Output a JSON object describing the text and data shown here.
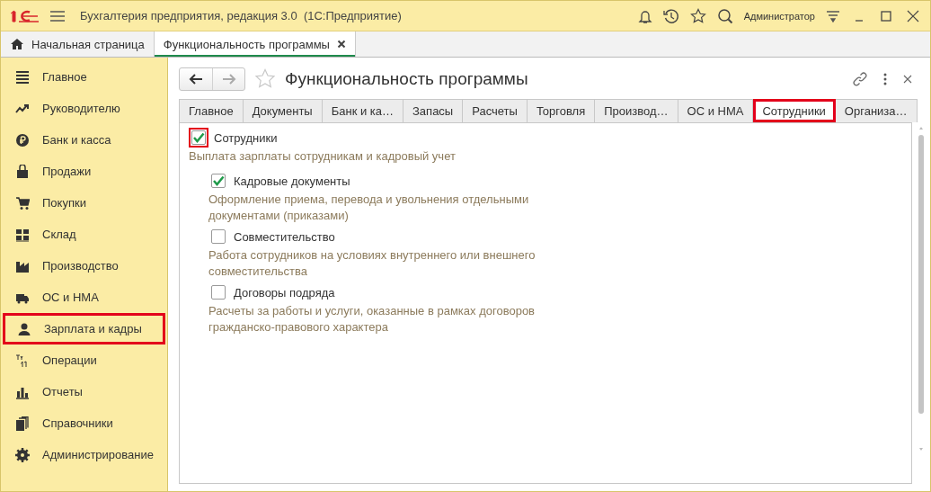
{
  "window": {
    "title": "Бухгалтерия предприятия, редакция 3.0  (1С:Предприятие)",
    "user": "Администратор"
  },
  "open_tabs": [
    {
      "label": "Начальная страница",
      "selected": false,
      "closable": false
    },
    {
      "label": "Функциональность программы",
      "selected": true,
      "closable": true
    }
  ],
  "sidebar": {
    "items": [
      {
        "label": "Главное",
        "highlighted": false
      },
      {
        "label": "Руководителю",
        "highlighted": false
      },
      {
        "label": "Банк и касса",
        "highlighted": false
      },
      {
        "label": "Продажи",
        "highlighted": false
      },
      {
        "label": "Покупки",
        "highlighted": false
      },
      {
        "label": "Склад",
        "highlighted": false
      },
      {
        "label": "Производство",
        "highlighted": false
      },
      {
        "label": "ОС и НМА",
        "highlighted": false
      },
      {
        "label": "Зарплата и кадры",
        "highlighted": true
      },
      {
        "label": "Операции",
        "highlighted": false
      },
      {
        "label": "Отчеты",
        "highlighted": false
      },
      {
        "label": "Справочники",
        "highlighted": false
      },
      {
        "label": "Администрирование",
        "highlighted": false
      }
    ]
  },
  "form": {
    "title": "Функциональность программы",
    "tabs": [
      {
        "label": "Главное",
        "selected": false,
        "highlighted": false
      },
      {
        "label": "Документы",
        "selected": false,
        "highlighted": false
      },
      {
        "label": "Банк и ка…",
        "selected": false,
        "highlighted": false
      },
      {
        "label": "Запасы",
        "selected": false,
        "highlighted": false
      },
      {
        "label": "Расчеты",
        "selected": false,
        "highlighted": false
      },
      {
        "label": "Торговля",
        "selected": false,
        "highlighted": false
      },
      {
        "label": "Производ…",
        "selected": false,
        "highlighted": false
      },
      {
        "label": "ОС и НМА",
        "selected": false,
        "highlighted": false
      },
      {
        "label": "Сотрудники",
        "selected": true,
        "highlighted": true
      },
      {
        "label": "Организа…",
        "selected": false,
        "highlighted": false
      }
    ],
    "options": [
      {
        "label": "Сотрудники",
        "checked": true,
        "highlighted": true,
        "description": "Выплата зарплаты сотрудникам и кадровый учет",
        "children": [
          {
            "label": "Кадровые документы",
            "checked": true,
            "highlighted": false,
            "description": "Оформление приема, перевода и увольнения отдельными документами (приказами)"
          },
          {
            "label": "Совместительство",
            "checked": false,
            "highlighted": false,
            "description": "Работа сотрудников на условиях внутреннего или внешнего совместительства"
          },
          {
            "label": "Договоры подряда",
            "checked": false,
            "highlighted": false,
            "description": "Расчеты за работы и услуги, оказанные в рамках договоров гражданско-правового характера"
          }
        ]
      }
    ]
  }
}
